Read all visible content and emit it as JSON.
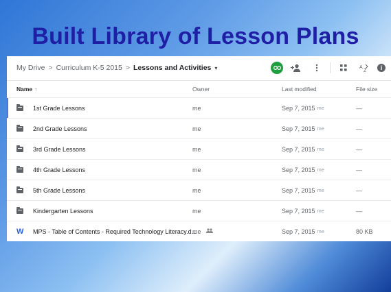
{
  "slide": {
    "title": "Built Library of Lesson Plans"
  },
  "breadcrumb": {
    "items": [
      "My Drive",
      "Curriculum K-5 2015"
    ],
    "current": "Lessons and Activities",
    "separator": ">",
    "caret": "▾"
  },
  "toolbar": {
    "link_icon": "link-icon",
    "add_person_icon": "add-person-icon",
    "more_icon": "more-vert-icon",
    "grid_icon": "grid-view-icon",
    "sort_icon": "sort-az-icon",
    "info_icon": "info-icon"
  },
  "table": {
    "headers": {
      "name": "Name",
      "name_sort": "↑",
      "owner": "Owner",
      "modified": "Last modified",
      "size": "File size"
    },
    "rows": [
      {
        "name": "1st Grade Lessons",
        "type": "folder",
        "owner": "me",
        "modified": "Sep 7, 2015",
        "by": "me",
        "size": "—"
      },
      {
        "name": "2nd Grade Lessons",
        "type": "folder",
        "owner": "me",
        "modified": "Sep 7, 2015",
        "by": "me",
        "size": "—"
      },
      {
        "name": "3rd Grade Lessons",
        "type": "folder",
        "owner": "me",
        "modified": "Sep 7, 2015",
        "by": "me",
        "size": "—"
      },
      {
        "name": "4th Grade Lessons",
        "type": "folder",
        "owner": "me",
        "modified": "Sep 7, 2015",
        "by": "me",
        "size": "—"
      },
      {
        "name": "5th Grade Lessons",
        "type": "folder",
        "owner": "me",
        "modified": "Sep 7, 2015",
        "by": "me",
        "size": "—"
      },
      {
        "name": "Kindergarten Lessons",
        "type": "folder",
        "owner": "me",
        "modified": "Sep 7, 2015",
        "by": "me",
        "size": "—"
      },
      {
        "name": "MPS - Table of Contents - Required Technology Literacy.d...",
        "type": "word",
        "owner": "me",
        "modified": "Sep 7, 2015",
        "by": "me",
        "size": "80 KB",
        "shared": true
      }
    ]
  },
  "colors": {
    "title": "#1f1fa6",
    "link_button": "#1e9e3e",
    "word_icon": "#2a5fd6"
  }
}
